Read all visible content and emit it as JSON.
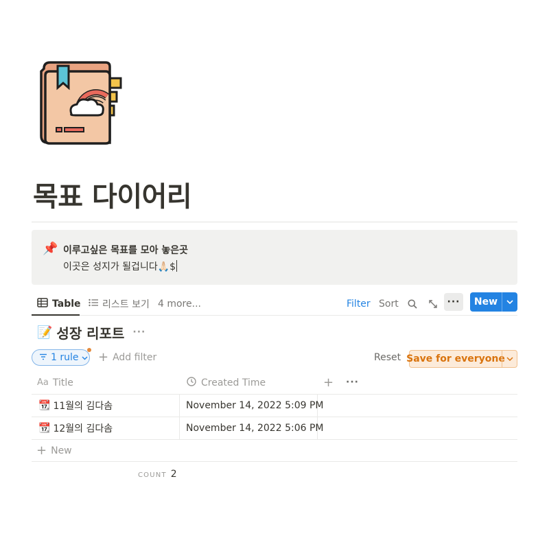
{
  "page": {
    "title": "목표 다이어리",
    "icon": "diary-book-icon"
  },
  "callout": {
    "icon": "📌",
    "line1": "이루고싶은 목표를 모아 놓은곳",
    "line2": "이곳은 성지가 될겁니다🙏🏻$"
  },
  "views": {
    "tabs": [
      {
        "label": "Table",
        "icon": "table-icon",
        "active": true
      },
      {
        "label": "리스트 보기",
        "icon": "list-icon",
        "active": false
      }
    ],
    "more_label": "4 more...",
    "filter_label": "Filter",
    "sort_label": "Sort",
    "more_menu": "···",
    "new_label": "New"
  },
  "database": {
    "emoji": "📝",
    "title": "성장 리포트",
    "menu": "···"
  },
  "filters": {
    "rule_label": "1 rule",
    "add_filter_label": "Add filter",
    "reset_label": "Reset",
    "save_label": "Save for everyone"
  },
  "table": {
    "columns": [
      {
        "label": "Title",
        "prefix": "Aa"
      },
      {
        "label": "Created Time",
        "icon": "clock-icon"
      }
    ],
    "add_column": "+",
    "column_menu": "···",
    "rows": [
      {
        "emoji": "📆",
        "title": "11월의 김다솜",
        "created": "November 14, 2022 5:09 PM"
      },
      {
        "emoji": "📆",
        "title": "12월의 김다솜",
        "created": "November 14, 2022 5:06 PM"
      }
    ],
    "new_row_label": "New",
    "count_label": "COUNT",
    "count_value": "2"
  },
  "colors": {
    "accent": "#2383e2",
    "save_text": "#d9730d",
    "save_bg": "#fcebda",
    "callout_bg": "#f1f1ef"
  }
}
